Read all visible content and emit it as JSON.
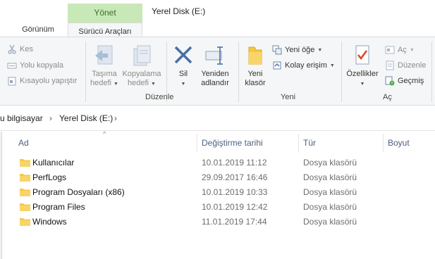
{
  "tabs": {
    "context_header": "Yönet",
    "view": "Görünüm",
    "drive_tools": "Sürücü Araçları"
  },
  "window": {
    "title": "Yerel Disk (E:)"
  },
  "ribbon": {
    "clipboard": {
      "cut": "Kes",
      "copy_path": "Yolu kopyala",
      "paste_shortcut": "Kısayolu yapıştır"
    },
    "organize": {
      "label": "Düzenle",
      "move_to_line1": "Taşıma",
      "move_to_line2": "hedefi",
      "copy_to_line1": "Kopyalama",
      "copy_to_line2": "hedefi",
      "delete": "Sil",
      "rename_line1": "Yeniden",
      "rename_line2": "adlandır"
    },
    "new": {
      "label": "Yeni",
      "new_folder_line1": "Yeni",
      "new_folder_line2": "klasör",
      "new_item": "Yeni öğe",
      "easy_access": "Kolay erişim"
    },
    "open": {
      "label": "Aç",
      "properties": "Özellikler",
      "open": "Aç",
      "edit": "Düzenle",
      "history": "Geçmiş"
    }
  },
  "address": {
    "crumbs": [
      "u bilgisayar",
      "Yerel Disk (E:)"
    ],
    "sep": "›"
  },
  "columns": {
    "name": "Ad",
    "modified": "Değiştirme tarihi",
    "type": "Tür",
    "size": "Boyut"
  },
  "files": [
    {
      "name": "Kullanıcılar",
      "modified": "10.01.2019 11:12",
      "type": "Dosya klasörü"
    },
    {
      "name": "PerfLogs",
      "modified": "29.09.2017 16:46",
      "type": "Dosya klasörü"
    },
    {
      "name": "Program Dosyaları (x86)",
      "modified": "10.01.2019 10:33",
      "type": "Dosya klasörü"
    },
    {
      "name": "Program Files",
      "modified": "10.01.2019 12:42",
      "type": "Dosya klasörü"
    },
    {
      "name": "Windows",
      "modified": "11.01.2019 17:44",
      "type": "Dosya klasörü"
    }
  ],
  "icons": {
    "cut": "scissors-icon",
    "copy_path": "copy-path-icon",
    "paste_shortcut": "paste-shortcut-icon",
    "move_to": "move-to-icon",
    "copy_to": "copy-to-icon",
    "delete": "delete-x-icon",
    "rename": "rename-icon",
    "new_folder": "new-folder-icon",
    "new_item": "new-item-icon",
    "easy_access": "easy-access-icon",
    "properties": "properties-icon",
    "open": "open-icon",
    "edit": "edit-icon",
    "history": "history-icon",
    "folder": "folder-icon"
  },
  "colors": {
    "context_tab": "#c9e8b8",
    "ribbon_bg": "#f5f6f7",
    "folder": "#f5c842",
    "delete_x": "#4a6fa5",
    "properties_check": "#d9482b"
  }
}
